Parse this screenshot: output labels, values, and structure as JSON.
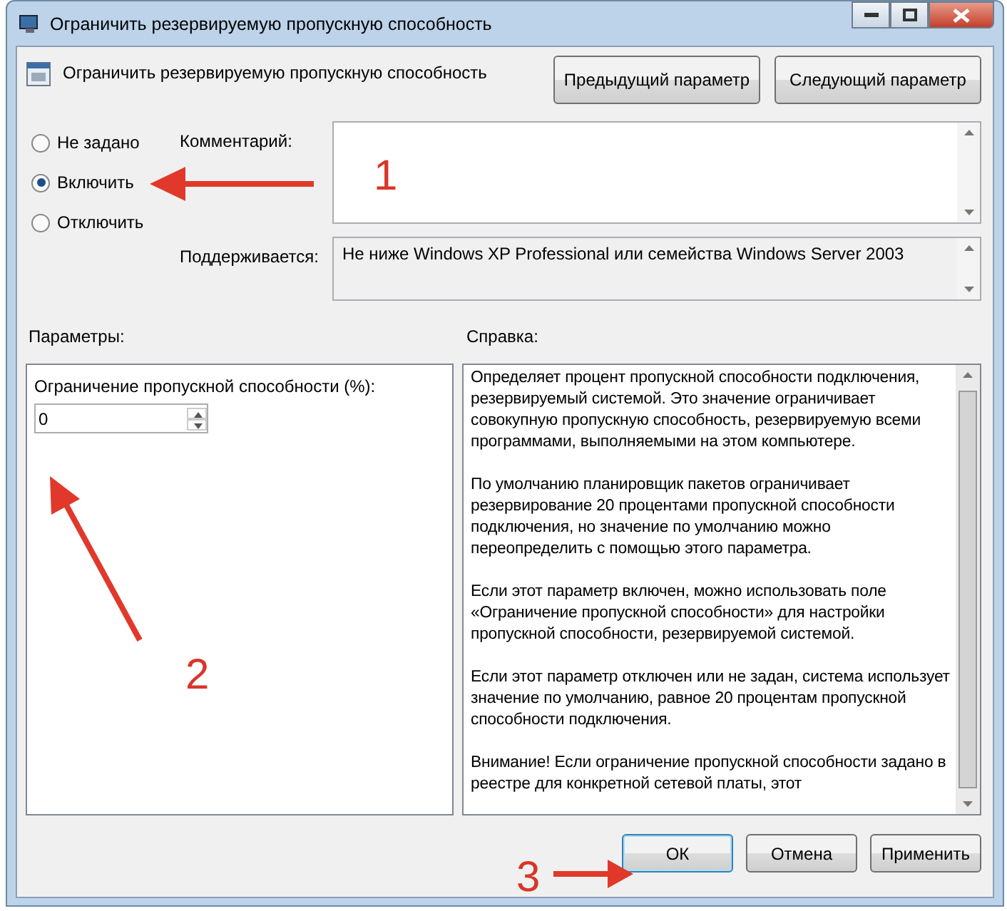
{
  "window": {
    "title": "Ограничить резервируемую пропускную способность"
  },
  "header": {
    "title": "Ограничить резервируемую пропускную способность",
    "buttons": [
      "Предыдущий параметр",
      "Следующий параметр"
    ]
  },
  "state_options": [
    {
      "label": "Не задано",
      "selected": false
    },
    {
      "label": "Включить",
      "selected": true
    },
    {
      "label": "Отключить",
      "selected": false
    }
  ],
  "comment": {
    "label": "Комментарий:"
  },
  "supported": {
    "label": "Поддерживается:",
    "value": "Не ниже Windows XP Professional или семейства Windows Server 2003"
  },
  "options_panel": {
    "heading": "Параметры:",
    "field_label": "Ограничение пропускной способности (%):",
    "field_value": "0"
  },
  "help_panel": {
    "heading": "Справка:",
    "paragraphs": [
      "Определяет процент пропускной способности подключения, резервируемый системой. Это значение ограничивает совокупную пропускную способность, резервируемую всеми программами, выполняемыми на этом компьютере.",
      "По умолчанию планировщик пакетов ограничивает резервирование 20 процентами пропускной способности подключения, но значение по умолчанию можно переопределить с помощью этого параметра.",
      "Если этот параметр включен, можно использовать поле «Ограничение пропускной способности» для настройки пропускной способности, резервируемой системой.",
      "Если этот параметр отключен или не задан, система использует значение по умолчанию, равное 20 процентам пропускной способности подключения.",
      "Внимание! Если ограничение пропускной способности задано в реестре для конкретной сетевой платы, этот"
    ]
  },
  "buttons": [
    "ОК",
    "Отмена",
    "Применить"
  ],
  "annotations": [
    {
      "label": "1"
    },
    {
      "label": "2"
    },
    {
      "label": "3"
    }
  ]
}
